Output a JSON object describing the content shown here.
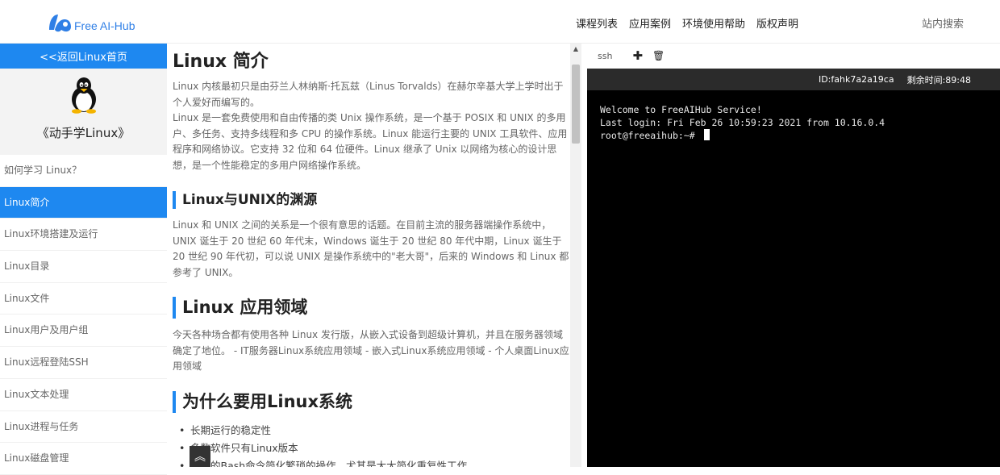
{
  "header": {
    "logo_text": "Free AI-Hub",
    "nav": [
      "课程列表",
      "应用案例",
      "环境使用帮助",
      "版权声明"
    ],
    "search_label": "站内搜索"
  },
  "sidebar": {
    "back_label": "<<返回Linux首页",
    "book_title": "《动手学Linux》",
    "items": [
      {
        "label": "如何学习 Linux？",
        "active": false
      },
      {
        "label": "Linux简介",
        "active": true
      },
      {
        "label": "Linux环境搭建及运行",
        "active": false
      },
      {
        "label": "Linux目录",
        "active": false
      },
      {
        "label": "Linux文件",
        "active": false
      },
      {
        "label": "Linux用户及用户组",
        "active": false
      },
      {
        "label": "Linux远程登陆SSH",
        "active": false
      },
      {
        "label": "Linux文本处理",
        "active": false
      },
      {
        "label": "Linux进程与任务",
        "active": false
      },
      {
        "label": "Linux磁盘管理",
        "active": false
      }
    ]
  },
  "article": {
    "title": "Linux 简介",
    "intro_p1": "Linux 内核最初只是由芬兰人林纳斯·托瓦兹（Linus Torvalds）在赫尔辛基大学上学时出于个人爱好而编写的。",
    "intro_p2": "Linux 是一套免费使用和自由传播的类 Unix 操作系统，是一个基于 POSIX 和 UNIX 的多用户、多任务、支持多线程和多 CPU 的操作系统。Linux 能运行主要的 UNIX 工具软件、应用程序和网络协议。它支持 32 位和 64 位硬件。Linux 继承了 Unix 以网络为核心的设计思想，是一个性能稳定的多用户网络操作系统。",
    "s1_title": "Linux与UNIX的渊源",
    "s1_p": "Linux 和 UNIX 之间的关系是一个很有意思的话题。在目前主流的服务器端操作系统中，UNIX 诞生于 20 世纪 60 年代末，Windows 诞生于 20 世纪 80 年代中期，Linux 诞生于 20 世纪 90 年代初，可以说 UNIX 是操作系统中的\"老大哥\"，后来的 Windows 和 Linux 都参考了 UNIX。",
    "s2_title": "Linux 应用领域",
    "s2_p": "今天各种场合都有使用各种 Linux 发行版，从嵌入式设备到超级计算机，并且在服务器领域确定了地位。 - IT服务器Linux系统应用领域 - 嵌入式Linux系统应用领域 - 个人桌面Linux应用领域",
    "s3_title": "为什么要用Linux系统",
    "bullets": [
      "长期运行的稳定性",
      "多数软件只有Linux版本",
      "熟练的Bash命令简化繁琐的操作，尤其是大大简化重复性工作"
    ]
  },
  "terminal": {
    "tab_label": "ssh",
    "add_icon": "plus-icon",
    "delete_icon": "trash-icon",
    "session_id": "ID:fahk7a2a19ca",
    "time_left": "剩余时间:89:48",
    "lines": [
      "Welcome to FreeAIHub Service!",
      "Last login: Fri Feb 26 10:59:23 2021 from 10.16.0.4",
      "root@freeaihub:~# "
    ]
  },
  "colors": {
    "accent": "#1e88f0",
    "terminal_bg": "#000000",
    "terminal_bar": "#2b2b2b"
  }
}
